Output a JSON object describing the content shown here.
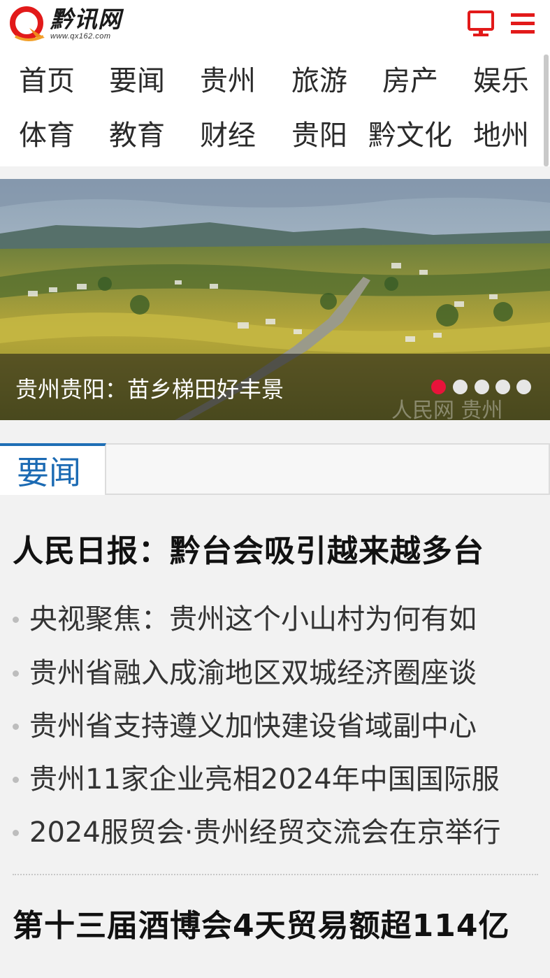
{
  "site": {
    "name": "黔讯网",
    "url": "www.qx162.com",
    "brand_color": "#e21a1a"
  },
  "header": {
    "pc_icon": "desktop-monitor-icon",
    "menu_icon": "hamburger-menu-icon"
  },
  "nav": {
    "items": [
      "首页",
      "要闻",
      "贵州",
      "旅游",
      "房产",
      "娱乐",
      "体育",
      "教育",
      "财经",
      "贵阳",
      "黔文化",
      "地州"
    ]
  },
  "banner": {
    "caption": "贵州贵阳：苗乡梯田好丰景",
    "slide_count": 5,
    "active_slide": 1,
    "watermark": "人民网 贵州",
    "active_dot_color": "#e8133a"
  },
  "section": {
    "tab_label": "要闻",
    "accent_color": "#1b6ab3"
  },
  "news": {
    "headline_1": "人民日报：黔台会吸引越来越多台",
    "items": [
      "央视聚焦：贵州这个小山村为何有如",
      "贵州省融入成渝地区双城经济圈座谈",
      "贵州省支持遵义加快建设省域副中心",
      "贵州11家企业亮相2024年中国国际服",
      "2024服贸会·贵州经贸交流会在京举行"
    ],
    "headline_2": "第十三届酒博会4天贸易额超114亿"
  }
}
